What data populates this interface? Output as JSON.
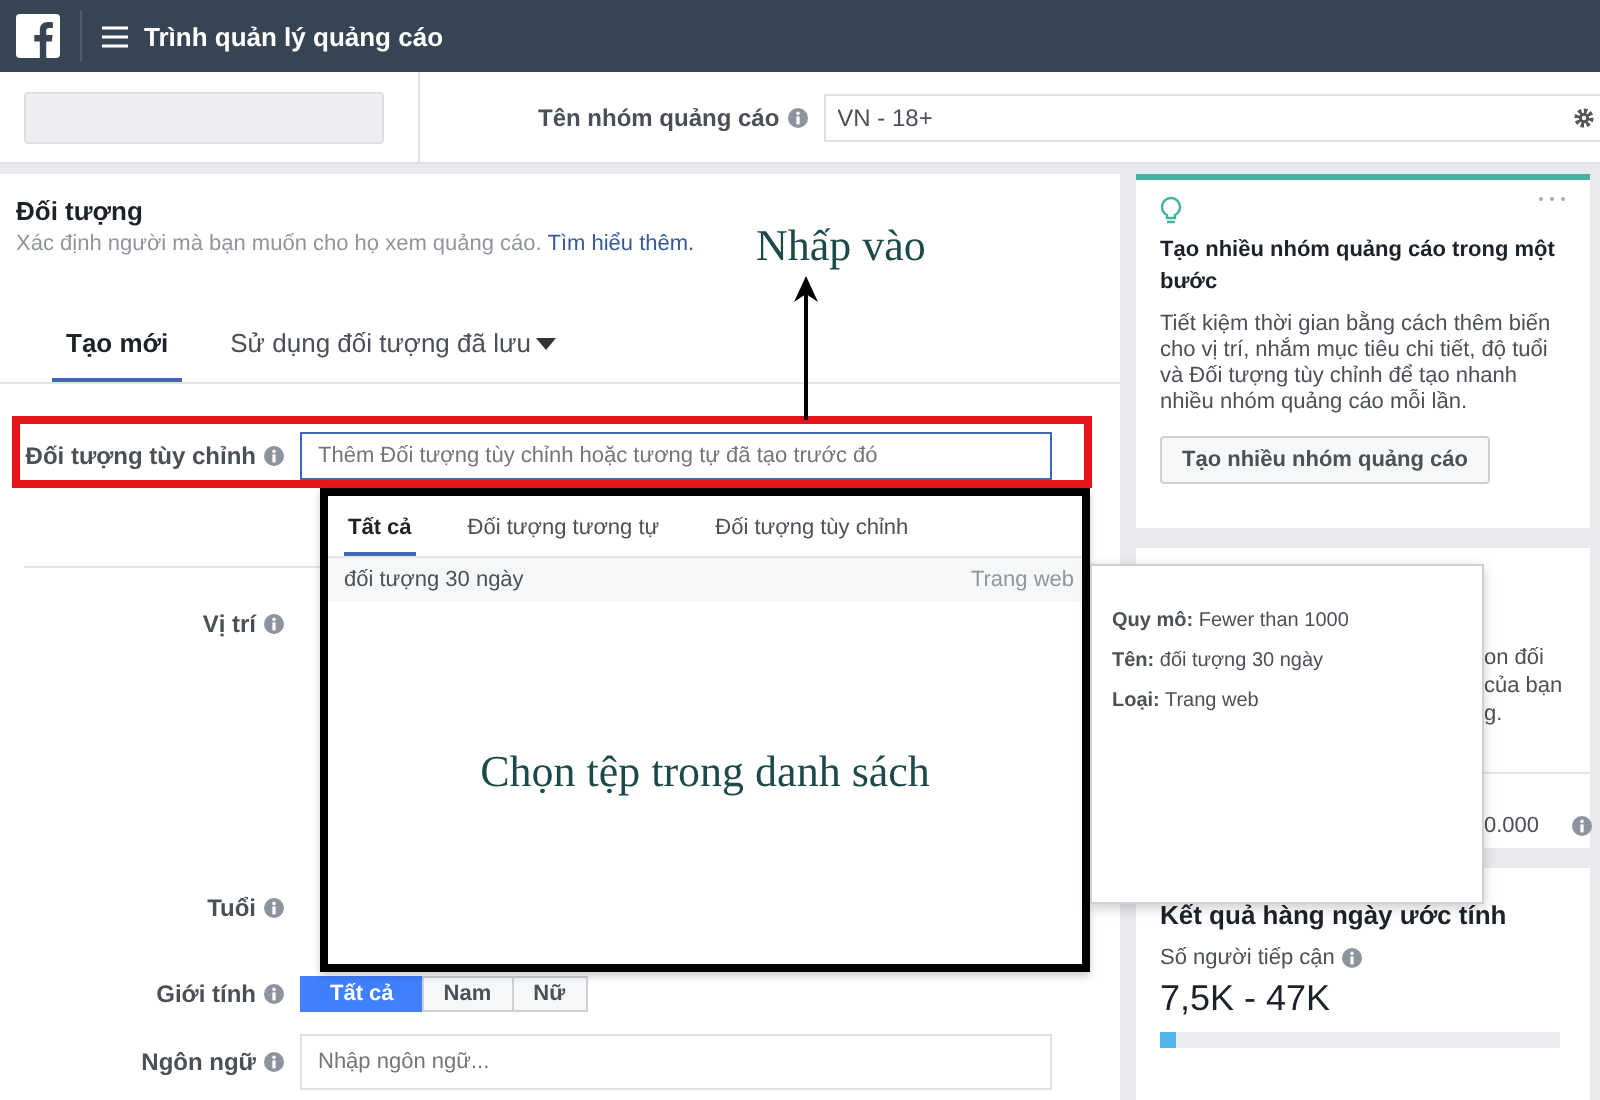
{
  "topbar": {
    "title": "Trình quản lý quảng cáo"
  },
  "ad_set_name": {
    "label": "Tên nhóm quảng cáo",
    "value": "VN - 18+"
  },
  "audience": {
    "title": "Đối tượng",
    "description": "Xác định người mà bạn muốn cho họ xem quảng cáo.",
    "link": "Tìm hiểu thêm.",
    "tabs": [
      {
        "label": "Tạo mới",
        "selected": true,
        "dropdown": false
      },
      {
        "label": "Sử dụng đối tượng đã lưu",
        "selected": false,
        "dropdown": true
      }
    ],
    "custom_audience": {
      "label": "Đối tượng tùy chỉnh",
      "placeholder": "Thêm Đối tượng tùy chỉnh hoặc tương tự đã tạo trước đó"
    },
    "fields": [
      {
        "kind": "blank",
        "label": "Vị trí"
      },
      {
        "kind": "blank",
        "label": "Tuổi"
      },
      {
        "kind": "segmented",
        "label": "Giới tính",
        "options": [
          {
            "label": "Tất cả",
            "selected": true
          },
          {
            "label": "Nam",
            "selected": false
          },
          {
            "label": "Nữ",
            "selected": false
          }
        ]
      },
      {
        "kind": "input",
        "label": "Ngôn ngữ",
        "placeholder": "Nhập ngôn ngữ..."
      }
    ]
  },
  "dropdown": {
    "tabs": [
      {
        "label": "Tất cả",
        "selected": true
      },
      {
        "label": "Đối tượng tương tự",
        "selected": false
      },
      {
        "label": "Đối tượng tùy chỉnh",
        "selected": false
      }
    ],
    "items": [
      {
        "name": "đối tượng 30 ngày",
        "type": "Trang web"
      }
    ]
  },
  "tooltip": {
    "lines": [
      "**Quy mô:** Fewer than 1000",
      "**Tên:** đối tượng 30 ngày",
      "**Loại:** Trang web"
    ]
  },
  "annotations": {
    "click_label": "Nhấp vào",
    "list_label": "Chọn tệp trong danh sách"
  },
  "tip_card": {
    "title": "Tạo nhiều nhóm quảng cáo trong một bước",
    "text": "Tiết kiệm thời gian bằng cách thêm biến cho vị trí, nhắm mục tiêu chi tiết, độ tuổi và Đối tượng tùy chỉnh để tạo nhanh nhiều nhóm quảng cáo mỗi lần.",
    "button": "Tạo nhiều nhóm quảng cáo"
  },
  "audience_card": {
    "lines": [
      "on đối",
      "của bạn",
      "g."
    ],
    "value": "0.000"
  },
  "results": {
    "title": "Kết quả hàng ngày ước tính",
    "label": "Số người tiếp cận",
    "value": "7,5K - 47K",
    "level": 0.04
  }
}
